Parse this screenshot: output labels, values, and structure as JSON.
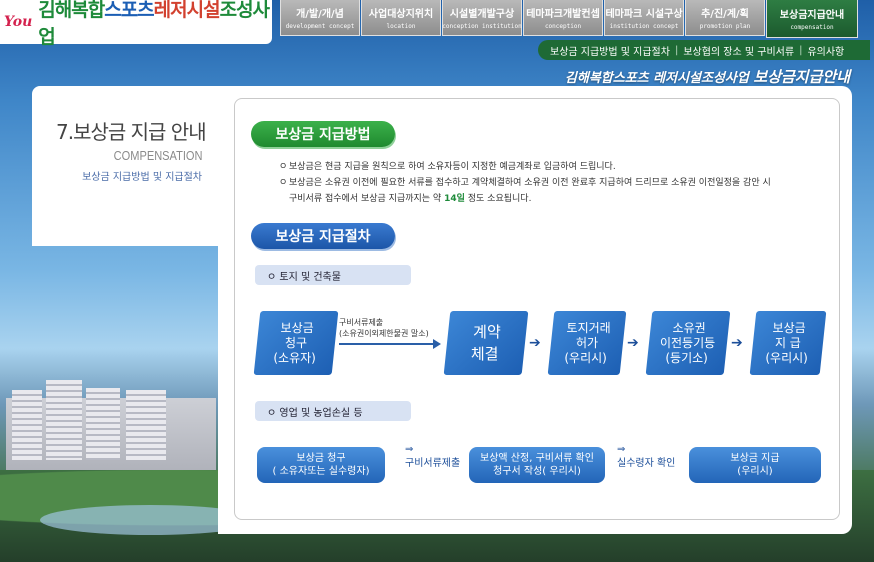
{
  "header": {
    "logo_mark": "You",
    "logo": {
      "p1": "김해복합",
      "p2": "스포츠",
      "p3": "레저시설",
      "p4": "조성사업"
    },
    "tabs": [
      {
        "ko": "개/발/개/념",
        "en": "development concept"
      },
      {
        "ko": "사업대상지위치",
        "en": "location"
      },
      {
        "ko": "시설별개발구상",
        "en": "conception institution"
      },
      {
        "ko": "테마파크개발컨셉",
        "en": "conception"
      },
      {
        "ko": "테마파크 시설구상",
        "en": "institution concept"
      },
      {
        "ko": "추/진/계/획",
        "en": "promotion plan"
      },
      {
        "ko": "보상금지급안내",
        "en": "compensation"
      }
    ]
  },
  "subnav": {
    "items": [
      "보상금 지급방법 및 지급절차",
      "보상협의 장소 및 구비서류",
      "유의사항"
    ],
    "separator": "|"
  },
  "page_heading": {
    "prefix": "김해복합스포츠 레저시설조성사업",
    "title": "보상금지급안내"
  },
  "left": {
    "title": "7.보상금 지급 안내",
    "english": "COMPENSATION",
    "sub": "보상금 지급방법 및 지급절차"
  },
  "method": {
    "label": "보상금  지급방법",
    "bullet1": "보상금은 현금 지급을 원칙으로 하여 소유자등이 지정한 예금계좌로 입금하여 드립니다.",
    "bullet2a": "보상금은 소유권 이전에 필요한 서류를 접수하고 계약체결하여 소유권 이전 완료후 지급하여 드리므로 소유권 이전일정을 감안 시",
    "bullet2b_pre": "구비서류  접수에서 보상금 지급까지는 약 ",
    "bullet2b_hl": "14일",
    "bullet2b_post": " 정도 소요됩니다.",
    "dot": "ㅇ"
  },
  "procedure": {
    "label": "보상금  지급절차",
    "section1": "ㅇ 토지 및 건축물",
    "section2": "ㅇ 영업 및 농업손실 등",
    "flow1": [
      {
        "l1": "보상금",
        "l2": "청구",
        "l3": "(소유자)"
      },
      {
        "l1": "계약",
        "l2": "체결"
      },
      {
        "l1": "토지거래",
        "l2": "허가",
        "l3": "(우리시)"
      },
      {
        "l1": "소유권",
        "l2": "이전등기등",
        "l3": "(등기소)"
      },
      {
        "l1": "보상금",
        "l2": "지 급",
        "l3": "(우리시)"
      }
    ],
    "flow1_note_l1": "구비서류제출",
    "flow1_note_l2": "(소유권이외제한물권 말소)",
    "arrow": "➔",
    "flow2": [
      {
        "l1": "보상금 청구",
        "l2": "( 소유자또는 실수령자)"
      },
      {
        "l1": "보상액 산정, 구비서류 확인",
        "l2": "청구서 작성( 우리시)"
      },
      {
        "l1": "보상금 지급",
        "l2": "(우리시)"
      }
    ],
    "flow2_mid1_arrow": "⇒",
    "flow2_mid1": "구비서류제출",
    "flow2_mid2_arrow": "⇒",
    "flow2_mid2": "실수령자 확인"
  }
}
